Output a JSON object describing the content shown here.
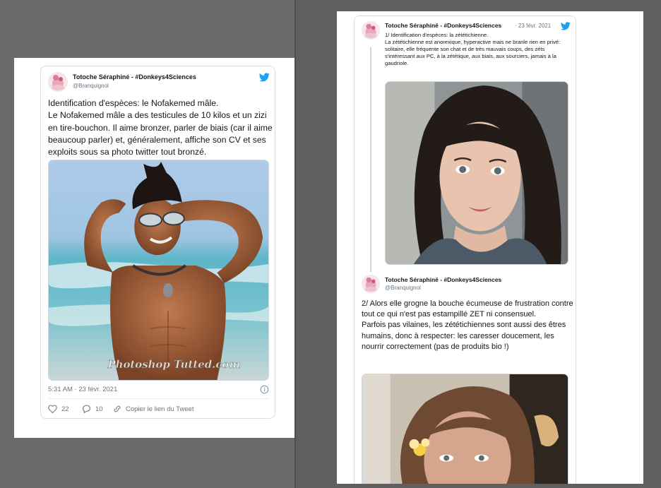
{
  "left_tweet": {
    "author_name": "Totoche Séraphiné - #Donkeys4Sciences",
    "handle": "@Branquignol",
    "text": "Identification d'espèces: le Nofakemed mâle.\nLe Nofakemed mâle a des testicules de 10 kilos et un zizi en tire-bouchon. Il aime bronzer, parler de biais (car il aime beaucoup parler) et, généralement, affiche son CV et ses exploits sous sa photo twitter tout bronzé.",
    "image_watermark": "Photoshop Tutted.com",
    "timestamp": "5:31 AM · 23 févr. 2021",
    "likes": "22",
    "replies": "10",
    "copy_link_label": "Copier le lien du Tweet"
  },
  "right_thread": {
    "tweet1": {
      "author_name": "Totoche Séraphiné - #Donkeys4Sciences",
      "date": "· 23 févr. 2021",
      "text": "1/ Identification d'espèces: la zététichienne.\nLa zététichienne est anorexique, hyperactive mais ne branle rien en privé: solitaire, elle fréquente son chat et de très mauvais coups, des zéts s'intéressant aux PC, à la zététique, aux biais, aux sourciers, jamais à la gaudriole."
    },
    "tweet2": {
      "author_name": "Totoche Séraphiné - #Donkeys4Sciences",
      "handle": "@Branquignol",
      "text": "2/ Alors elle grogne la bouche écumeuse de frustration contre tout ce qui n'est pas estampillé ZET ni consensuel.\nParfois pas vilaines, les zététichiennes sont aussi des êtres humains, donc à respecter: les caresser doucement, les nourrir correctement (pas de produits bio !)"
    }
  },
  "colors": {
    "twitter_blue": "#1da1f2",
    "text_primary": "#14171a",
    "text_secondary": "#657786"
  },
  "icons": [
    "twitter-bird-icon",
    "info-icon",
    "heart-icon",
    "reply-icon",
    "link-icon"
  ]
}
